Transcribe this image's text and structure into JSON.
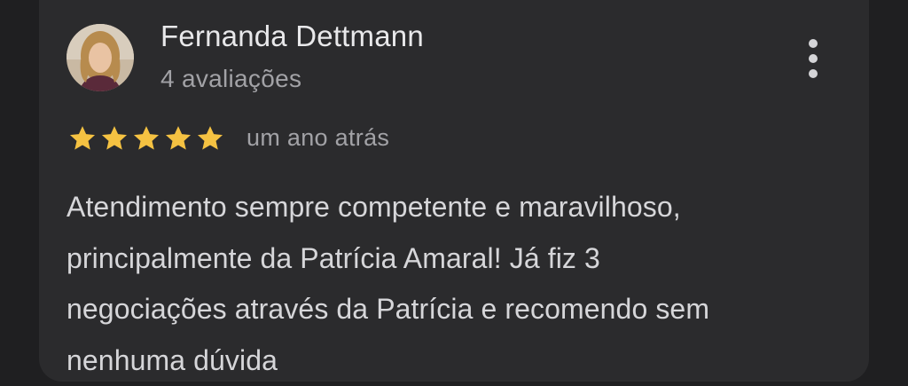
{
  "review": {
    "author_name": "Fernanda Dettmann",
    "author_reviews": "4 avaliações",
    "rating": 5,
    "rating_max": 5,
    "time_ago": "um ano atrás",
    "text_lines": [
      "Atendimento sempre competente e maravilhoso,",
      "principalmente da Patrícia Amaral! Já fiz 3",
      "negociações através da Patrícia e recomendo sem",
      "nenhuma dúvida"
    ]
  },
  "icons": {
    "menu": "more-vert-icon",
    "star": "star-icon"
  },
  "colors": {
    "background": "#1f1f21",
    "card": "#2b2b2d",
    "star": "#f5c242",
    "primary_text": "#e8e8ea",
    "secondary_text": "#a2a2a6"
  }
}
